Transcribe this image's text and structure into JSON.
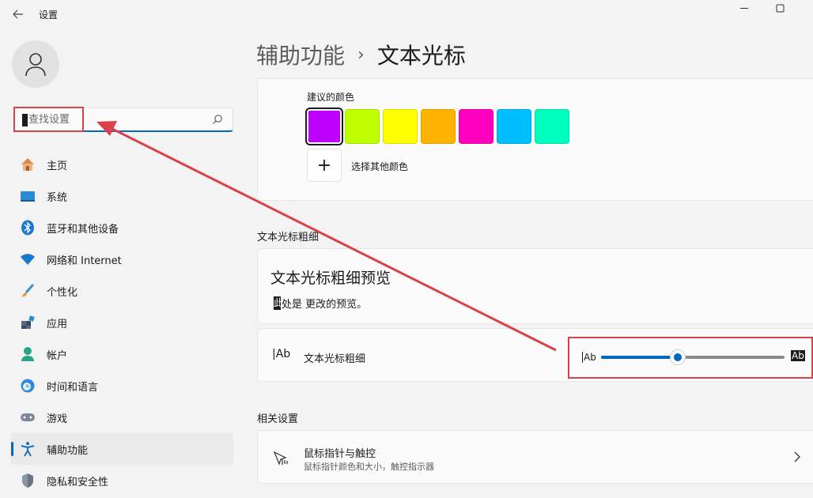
{
  "window": {
    "title": "设置"
  },
  "sidebar": {
    "search_placeholder": "查找设置",
    "items": [
      {
        "label": "主页",
        "icon": "home-icon"
      },
      {
        "label": "系统",
        "icon": "system-icon"
      },
      {
        "label": "蓝牙和其他设备",
        "icon": "bluetooth-icon"
      },
      {
        "label": "网络和 Internet",
        "icon": "wifi-icon"
      },
      {
        "label": "个性化",
        "icon": "brush-icon"
      },
      {
        "label": "应用",
        "icon": "apps-icon"
      },
      {
        "label": "帐户",
        "icon": "account-icon"
      },
      {
        "label": "时间和语言",
        "icon": "time-language-icon"
      },
      {
        "label": "游戏",
        "icon": "gamepad-icon"
      },
      {
        "label": "辅助功能",
        "icon": "accessibility-icon",
        "active": true
      },
      {
        "label": "隐私和安全性",
        "icon": "shield-icon"
      }
    ]
  },
  "header": {
    "parent": "辅助功能",
    "separator": "›",
    "current": "文本光标"
  },
  "colors_card": {
    "suggested_label": "建议的颜色",
    "swatches": [
      "#bf00ff",
      "#bfff00",
      "#ffff00",
      "#ffb300",
      "#ff00bf",
      "#00bfff",
      "#00ffbf"
    ],
    "selected_index": 0,
    "add_label": "选择其他颜色",
    "add_symbol": "+"
  },
  "thickness_section": {
    "title": "文本光标粗细",
    "preview_title": "文本光标粗细预览",
    "preview_caret_char": "此",
    "preview_text": "处是 更改的预览。",
    "setting_icon_text": "|Ab",
    "setting_label": "文本光标粗细",
    "slider_min_label": "Ab",
    "slider_max_label": "Ab",
    "slider_value_fraction": 0.42
  },
  "related": {
    "title": "相关设置",
    "item_title": "鼠标指针与触控",
    "item_subtitle": "鼠标指针颜色和大小，触控指示器"
  },
  "accent_color": "#0067c0",
  "annotation_color": "#d9424a"
}
